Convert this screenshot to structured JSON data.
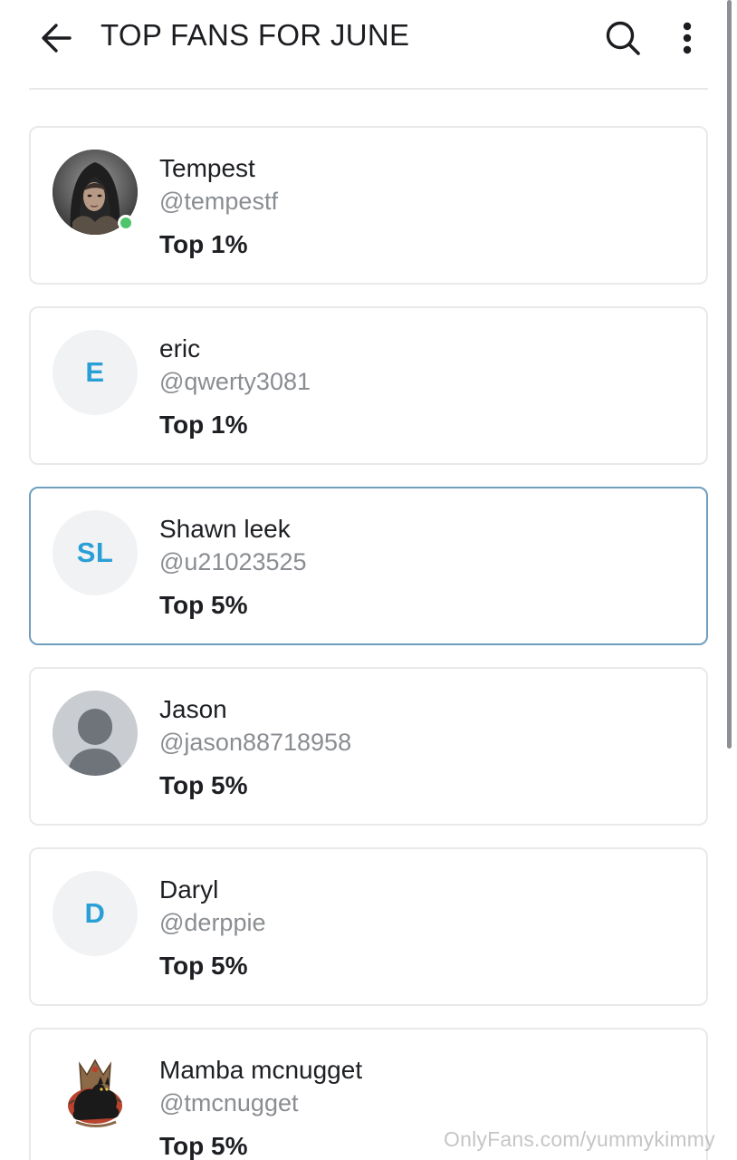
{
  "header": {
    "title": "TOP FANS FOR JUNE",
    "back_icon": "arrow-left-icon",
    "search_icon": "search-icon",
    "more_icon": "more-vertical-icon"
  },
  "colors": {
    "initials": "#2a9fd6",
    "online": "#4fc56b",
    "selected_border": "#6f9fbd",
    "card_border": "#e7e9eb",
    "handle_text": "#8a8d91"
  },
  "fans": [
    {
      "name": "Tempest",
      "handle": "@tempestf",
      "rank": "Top 1%",
      "avatar_type": "photo",
      "avatar_icon": "hooded-figure-photo",
      "online": true
    },
    {
      "name": "eric",
      "handle": "@qwerty3081",
      "rank": "Top 1%",
      "avatar_type": "initials",
      "initials": "E"
    },
    {
      "name": "Shawn leek",
      "handle": "@u21023525",
      "rank": "Top 5%",
      "avatar_type": "initials",
      "initials": "SL",
      "selected": true
    },
    {
      "name": "Jason",
      "handle": "@jason88718958",
      "rank": "Top 5%",
      "avatar_type": "placeholder",
      "avatar_icon": "person-placeholder-icon"
    },
    {
      "name": "Daryl",
      "handle": "@derppie",
      "rank": "Top 5%",
      "avatar_type": "initials",
      "initials": "D"
    },
    {
      "name": "Mamba mcnugget",
      "handle": "@tmcnugget",
      "rank": "Top 5%",
      "avatar_type": "photo",
      "avatar_icon": "black-cat-emblem-photo"
    }
  ],
  "watermark": "OnlyFans.com/yummykimmy"
}
